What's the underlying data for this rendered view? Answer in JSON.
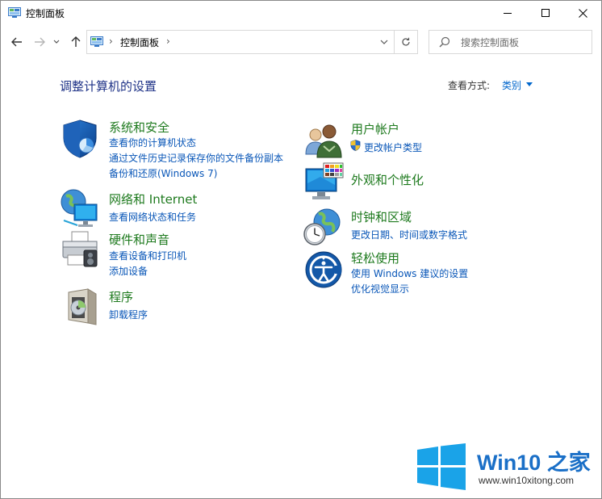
{
  "window": {
    "title": "控制面板",
    "controls": {
      "minimize": "—",
      "maximize": "☐",
      "close": "✕"
    }
  },
  "navigation": {
    "address": {
      "path": "控制面板",
      "separator": "›"
    },
    "search_placeholder": "搜索控制面板"
  },
  "main": {
    "heading": "调整计算机的设置",
    "view_by_label": "查看方式:",
    "view_by_value": "类别"
  },
  "categories_left": [
    {
      "title": "系统和安全",
      "icon": "security-shield-icon",
      "links": [
        "查看你的计算机状态",
        "通过文件历史记录保存你的文件备份副本",
        "备份和还原(Windows 7)"
      ]
    },
    {
      "title": "网络和 Internet",
      "icon": "network-globe-icon",
      "links": [
        "查看网络状态和任务"
      ]
    },
    {
      "title": "硬件和声音",
      "icon": "printer-icon",
      "links": [
        "查看设备和打印机",
        "添加设备"
      ]
    },
    {
      "title": "程序",
      "icon": "programs-disc-icon",
      "links": [
        "卸载程序"
      ]
    }
  ],
  "categories_right": [
    {
      "title": "用户帐户",
      "icon": "users-icon",
      "links": [
        "更改帐户类型"
      ]
    },
    {
      "title": "外观和个性化",
      "icon": "monitor-palette-icon",
      "links": []
    },
    {
      "title": "时钟和区域",
      "icon": "clock-globe-icon",
      "links": [
        "更改日期、时间或数字格式"
      ]
    },
    {
      "title": "轻松使用",
      "icon": "ease-of-access-icon",
      "links": [
        "使用 Windows 建议的设置",
        "优化视觉显示"
      ]
    }
  ],
  "watermark": {
    "title": "Win10 之家",
    "url": "www.win10xitong.com"
  },
  "colors": {
    "category_title": "#1e7a1e",
    "link": "#0a57b8",
    "heading": "#1e3287",
    "watermark_blue": "#1a6fc7"
  }
}
